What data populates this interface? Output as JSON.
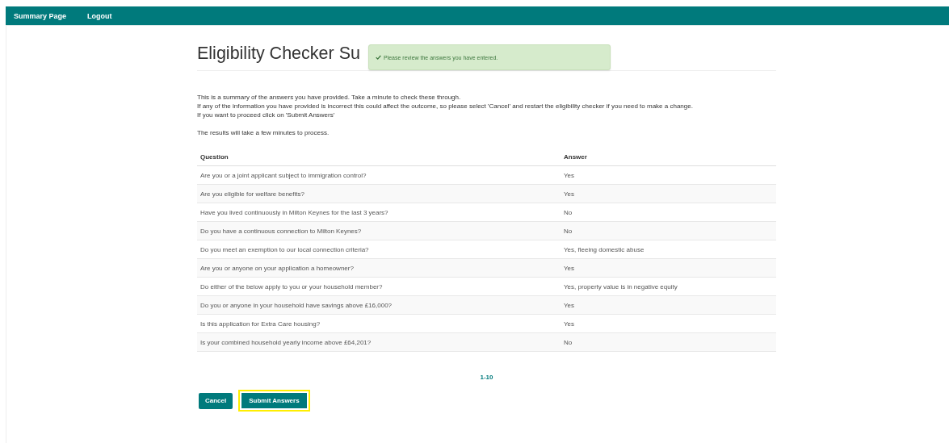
{
  "nav": {
    "items": [
      "Summary Page",
      "Logout"
    ]
  },
  "title": "Eligibility Checker Su",
  "toast": {
    "text": "Please review the answers you have entered."
  },
  "intro": [
    "This is a summary of the answers you have provided. Take a minute to check these through.",
    "If any of the information you have provided is incorrect this could affect the outcome, so please select 'Cancel' and restart the eligibility checker if you need to make a change.",
    "If you want to proceed click on 'Submit Answers'"
  ],
  "note": "The results will take a few minutes to process.",
  "table": {
    "columns": [
      "Question",
      "Answer"
    ],
    "rows": [
      [
        "Are you or a joint applicant subject to immigration control?",
        "Yes"
      ],
      [
        "Are you eligible for welfare benefits?",
        "Yes"
      ],
      [
        "Have you lived continuously in Milton Keynes for the last 3 years?",
        "No"
      ],
      [
        "Do you have a continuous connection to Milton Keynes?",
        "No"
      ],
      [
        "Do you meet an exemption to our local connection criteria?",
        "Yes, fleeing domestic abuse"
      ],
      [
        "Are you or anyone on your application a homeowner?",
        "Yes"
      ],
      [
        "Do either of the below apply to you or your household member?",
        "Yes, property value is in negative equity"
      ],
      [
        "Do you or anyone in your household have savings above £16,000?",
        "Yes"
      ],
      [
        "Is this application for Extra Care housing?",
        "Yes"
      ],
      [
        "Is your combined household yearly income above £64,201?",
        "No"
      ]
    ]
  },
  "pagination": "1-10",
  "buttons": [
    {
      "label": "Cancel",
      "focused": false
    },
    {
      "label": "Submit Answers",
      "focused": true
    }
  ]
}
